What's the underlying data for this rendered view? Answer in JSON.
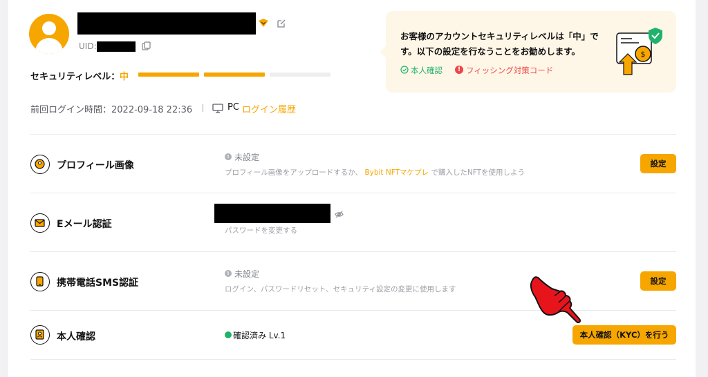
{
  "header": {
    "uid_label": "UID:",
    "security_label": "セキュリティレベル：",
    "security_level": "中",
    "security_level_bars": 2,
    "security_level_bars_total": 3,
    "last_login_label": "前回ログイン時間：2022-09-18 22:36",
    "device_label": "PC",
    "login_history_link": "ログイン履歴"
  },
  "notice": {
    "text": "お客様のアカウントセキュリティレベルは「中」です。以下の設定を行なうことをお勧めします。",
    "kyc_item": "本人確認",
    "phishing_item": "フィッシング対策コード"
  },
  "rows": [
    {
      "title": "プロフィール画像",
      "status": "未設定",
      "desc_before": "プロフィール画像をアップロードするか、",
      "desc_link": "Bybit NFTマケプレ",
      "desc_after": "で購入したNFTを使用しよう",
      "button": "設定"
    },
    {
      "title": "Eメール認証",
      "desc": "パスワードを変更する"
    },
    {
      "title": "携帯電話SMS認証",
      "status": "未設定",
      "desc": "ログイン、パスワードリセット、セキュリティ設定の変更に使用します",
      "button": "設定"
    },
    {
      "title": "本人確認",
      "status": "確認済み Lv.1",
      "button": "本人確認（KYC）を行う"
    }
  ],
  "colors": {
    "accent": "#f7a600",
    "success": "#20b26c",
    "danger": "#ef454a",
    "pointer_hand": "#e8141c"
  }
}
